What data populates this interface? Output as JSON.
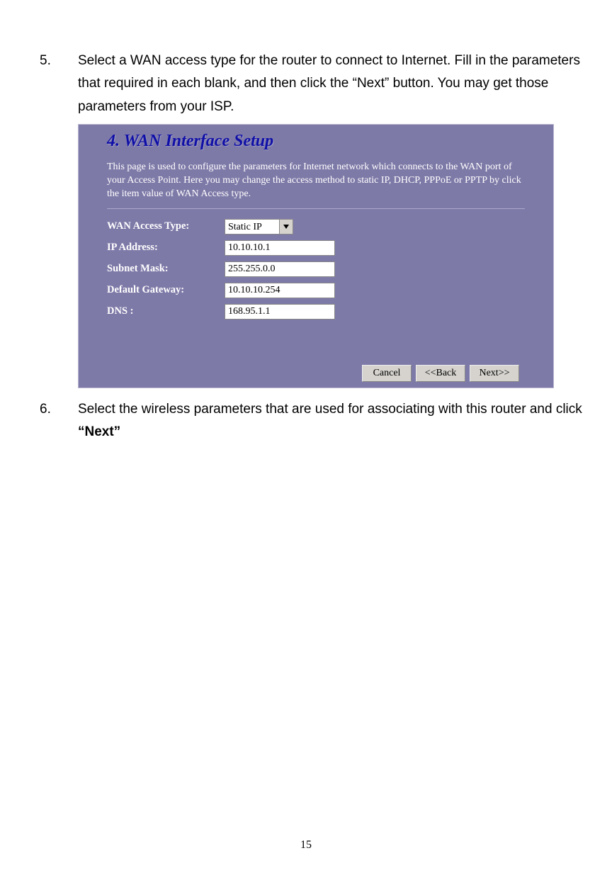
{
  "step5": {
    "num": "5.",
    "text": "Select a WAN access type for the router to connect to Internet. Fill in the parameters that required in each blank, and then click the “Next” button. You may get those parameters from your ISP."
  },
  "panel": {
    "title": "4. WAN Interface Setup",
    "desc": "This page is used to configure the parameters for Internet network which connects to the WAN port of your Access Point. Here you may change the access method to static IP, DHCP, PPPoE or PPTP by click the item value of WAN Access type.",
    "rows": {
      "access_type": {
        "label": "WAN Access Type:",
        "value": "Static IP"
      },
      "ip": {
        "label": "IP Address:",
        "value": "10.10.10.1"
      },
      "mask": {
        "label": "Subnet Mask:",
        "value": "255.255.0.0"
      },
      "gw": {
        "label": "Default Gateway:",
        "value": "10.10.10.254"
      },
      "dns": {
        "label": "DNS :",
        "value": "168.95.1.1"
      }
    },
    "buttons": {
      "cancel": "Cancel",
      "back": "<<Back",
      "next": "Next>>"
    }
  },
  "step6": {
    "num": "6.",
    "text_a": "Select the wireless parameters that are used for associating with this router and click ",
    "text_b": "“Next”"
  },
  "pagenum": "15"
}
